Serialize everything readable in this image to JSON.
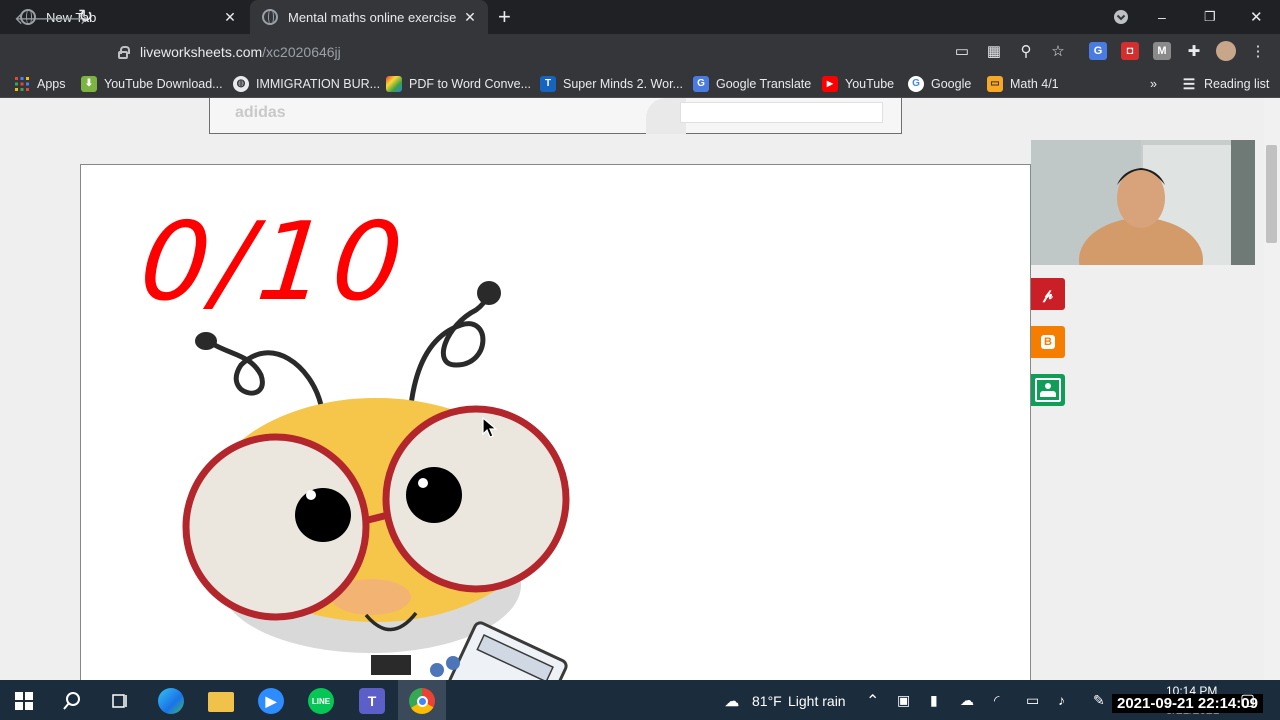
{
  "browser": {
    "tabs": [
      {
        "title": "New Tab"
      },
      {
        "title": "Mental maths online exercise for"
      }
    ],
    "new_tab": "+",
    "url_host": "liveworksheets.com",
    "url_path": "/xc2020646jj",
    "window_controls": {
      "minimize": "–",
      "restore": "❐",
      "close": "✕"
    },
    "bookmarks": [
      {
        "label": "Apps"
      },
      {
        "label": "YouTube Download..."
      },
      {
        "label": "IMMIGRATION BUR..."
      },
      {
        "label": "PDF to Word Conve..."
      },
      {
        "label": "Super Minds 2. Wor..."
      },
      {
        "label": "Google Translate"
      },
      {
        "label": "YouTube"
      },
      {
        "label": "Google"
      },
      {
        "label": "Math 4/1"
      }
    ],
    "bookmarks_overflow": "»",
    "reading_list": "Reading list"
  },
  "page": {
    "ad_label": "adidas",
    "score": "0/10",
    "share_icons": [
      "pinterest-icon",
      "blogger-icon",
      "google-classroom-icon"
    ],
    "share_colors": {
      "pinterest": "#cb1f27",
      "blogger": "#f57d00",
      "classroom": "#0f9d58"
    }
  },
  "taskbar": {
    "weather_temp": "81°F",
    "weather_text": "Light rain",
    "clock_time": "10:14 PM",
    "clock_date": "9/21/2021",
    "overlay_timestamp": "2021-09-21 22:14:09"
  },
  "colors": {
    "score_red": "#ff0000",
    "bee_yellow": "#f6c64b",
    "glasses_red": "#b3262b"
  }
}
